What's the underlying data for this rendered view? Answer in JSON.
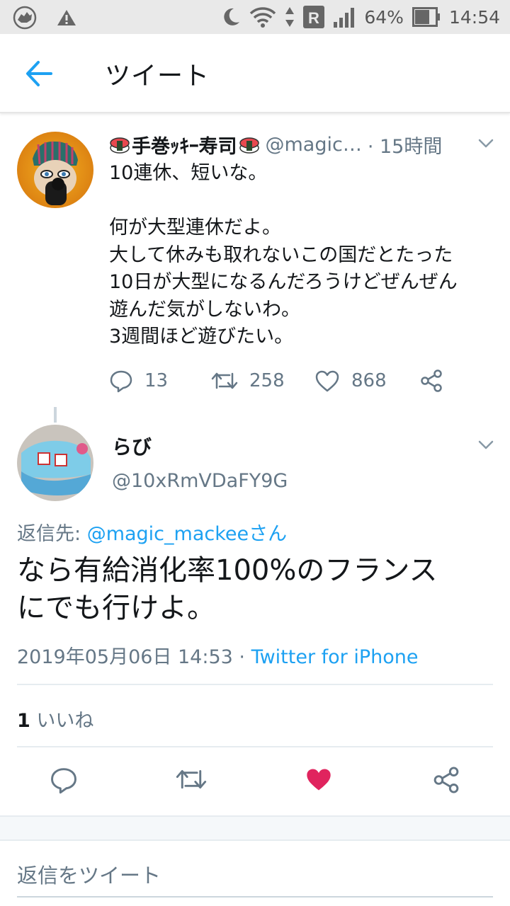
{
  "status_bar": {
    "battery": "64%",
    "time": "14:54",
    "roaming": "R"
  },
  "header": {
    "title": "ツイート"
  },
  "tweet": {
    "display_name": "手巻ｯｷｰ寿司",
    "handle": "@magic…",
    "time": "· 15時間",
    "lines": [
      "10連休、短いな。",
      "",
      "何が大型連休だよ。",
      "大して休みも取れないこの国だとたった",
      "10日が大型になるんだろうけどぜんぜん",
      "遊んだ気がしないわ。",
      "3週間ほど遊びたい。"
    ],
    "replies": "13",
    "retweets": "258",
    "likes": "868"
  },
  "reply": {
    "display_name": "らび",
    "handle": "@10xRmVDaFY9G",
    "reply_to_label": "返信先: ",
    "reply_to_mention": "@magic_mackeeさん",
    "text_line1": "なら有給消化率100%のフランス",
    "text_line2": "にでも行けよ。",
    "timestamp": "2019年05月06日 14:53 · ",
    "source": "Twitter for iPhone",
    "like_count": "1",
    "like_label": " いいね"
  },
  "compose": {
    "placeholder": "返信をツイート"
  },
  "colors": {
    "accent": "#1da1f2",
    "like": "#e0245e",
    "secondary_text": "#657786"
  }
}
